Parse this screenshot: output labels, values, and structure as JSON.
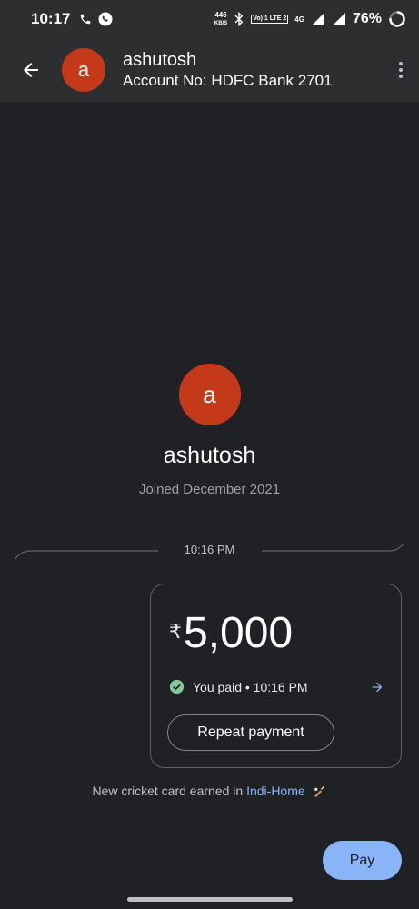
{
  "status_bar": {
    "time": "10:17",
    "net_speed_value": "446",
    "net_speed_unit": "KB/S",
    "volte_badge": "Vo) 1 LTE 2",
    "network_badge": "4G",
    "battery": "76%"
  },
  "header": {
    "avatar_initial": "a",
    "name": "ashutosh",
    "account": "Account No: HDFC Bank 2701"
  },
  "profile": {
    "avatar_initial": "a",
    "name": "ashutosh",
    "joined": "Joined December 2021"
  },
  "timeline": {
    "divider_time": "10:16 PM"
  },
  "payment": {
    "currency_symbol": "₹",
    "amount": "5,000",
    "status": "You paid • 10:16 PM",
    "repeat_label": "Repeat payment"
  },
  "reward": {
    "prefix": "New cricket card earned in ",
    "link": "Indi-Home"
  },
  "footer": {
    "pay_label": "Pay"
  },
  "colors": {
    "avatar": "#c5391b",
    "accent": "#8ab4f8",
    "success": "#81c995",
    "background": "#202124",
    "app_bar": "#2d2e30"
  }
}
